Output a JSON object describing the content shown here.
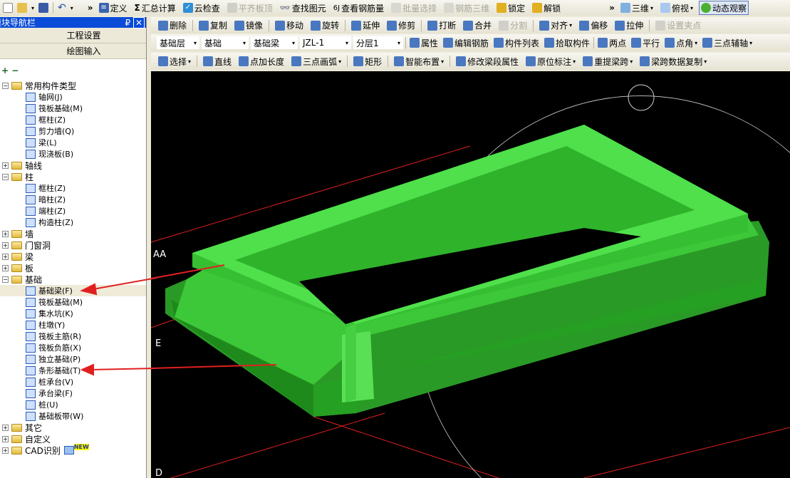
{
  "toolbar_main": {
    "items": [
      {
        "label": "定义",
        "icon": "define-icon"
      },
      {
        "label": "汇总计算",
        "icon": "sigma-icon"
      },
      {
        "label": "云检查",
        "icon": "cloud-check-icon"
      },
      {
        "label": "平齐板顶",
        "icon": "flush-icon",
        "disabled": true
      },
      {
        "label": "查找图元",
        "icon": "binoculars-icon"
      },
      {
        "label": "查看钢筋量",
        "icon": "rebar-icon"
      },
      {
        "label": "批量选择",
        "icon": "batch-icon",
        "disabled": true
      },
      {
        "label": "钢筋三维",
        "icon": "rebar3d-icon",
        "disabled": true
      },
      {
        "label": "锁定",
        "icon": "lock-icon"
      },
      {
        "label": "解锁",
        "icon": "unlock-icon"
      }
    ],
    "view_mode": "三维",
    "view_dir": "俯视",
    "orbit": "动态观察"
  },
  "nav": {
    "title": "模块导航栏",
    "buttons": [
      "工程设置",
      "绘图输入"
    ],
    "tree": [
      {
        "label": "常用构件类型",
        "open": true,
        "children": [
          "轴网(J)",
          "筏板基础(M)",
          "框柱(Z)",
          "剪力墙(Q)",
          "梁(L)",
          "现浇板(B)"
        ]
      },
      {
        "label": "轴线",
        "open": false
      },
      {
        "label": "柱",
        "open": true,
        "children": [
          "框柱(Z)",
          "暗柱(Z)",
          "端柱(Z)",
          "构造柱(Z)"
        ]
      },
      {
        "label": "墙",
        "open": false
      },
      {
        "label": "门窗洞",
        "open": false
      },
      {
        "label": "梁",
        "open": false
      },
      {
        "label": "板",
        "open": false
      },
      {
        "label": "基础",
        "open": true,
        "children": [
          "基础梁(F)",
          "筏板基础(M)",
          "集水坑(K)",
          "柱墩(Y)",
          "筏板主筋(R)",
          "筏板负筋(X)",
          "独立基础(P)",
          "条形基础(T)",
          "桩承台(V)",
          "承台梁(F)",
          "桩(U)",
          "基础板带(W)"
        ]
      },
      {
        "label": "其它",
        "open": false
      },
      {
        "label": "自定义",
        "open": false
      },
      {
        "label": "CAD识别",
        "open": false,
        "badge": "NEW"
      }
    ]
  },
  "edit_toolbar": [
    "删除",
    "复制",
    "镜像",
    "移动",
    "旋转",
    "延伸",
    "修剪",
    "打断",
    "合并",
    "分割",
    "对齐",
    "偏移",
    "拉伸",
    "设置夹点"
  ],
  "selectors": {
    "floor": "基础层",
    "category": "基础",
    "type": "基础梁",
    "name": "JZL-1",
    "layer": "分层1"
  },
  "prop_toolbar": [
    "属性",
    "编辑钢筋",
    "构件列表",
    "拾取构件",
    "两点",
    "平行",
    "点角",
    "三点辅轴"
  ],
  "draw_toolbar": [
    "选择",
    "直线",
    "点加长度",
    "三点画弧",
    "矩形",
    "智能布置",
    "修改梁段属性",
    "原位标注",
    "重提梁跨",
    "梁跨数据复制"
  ],
  "viewport": {
    "axis_labels": [
      "AA",
      "E",
      "D"
    ]
  }
}
